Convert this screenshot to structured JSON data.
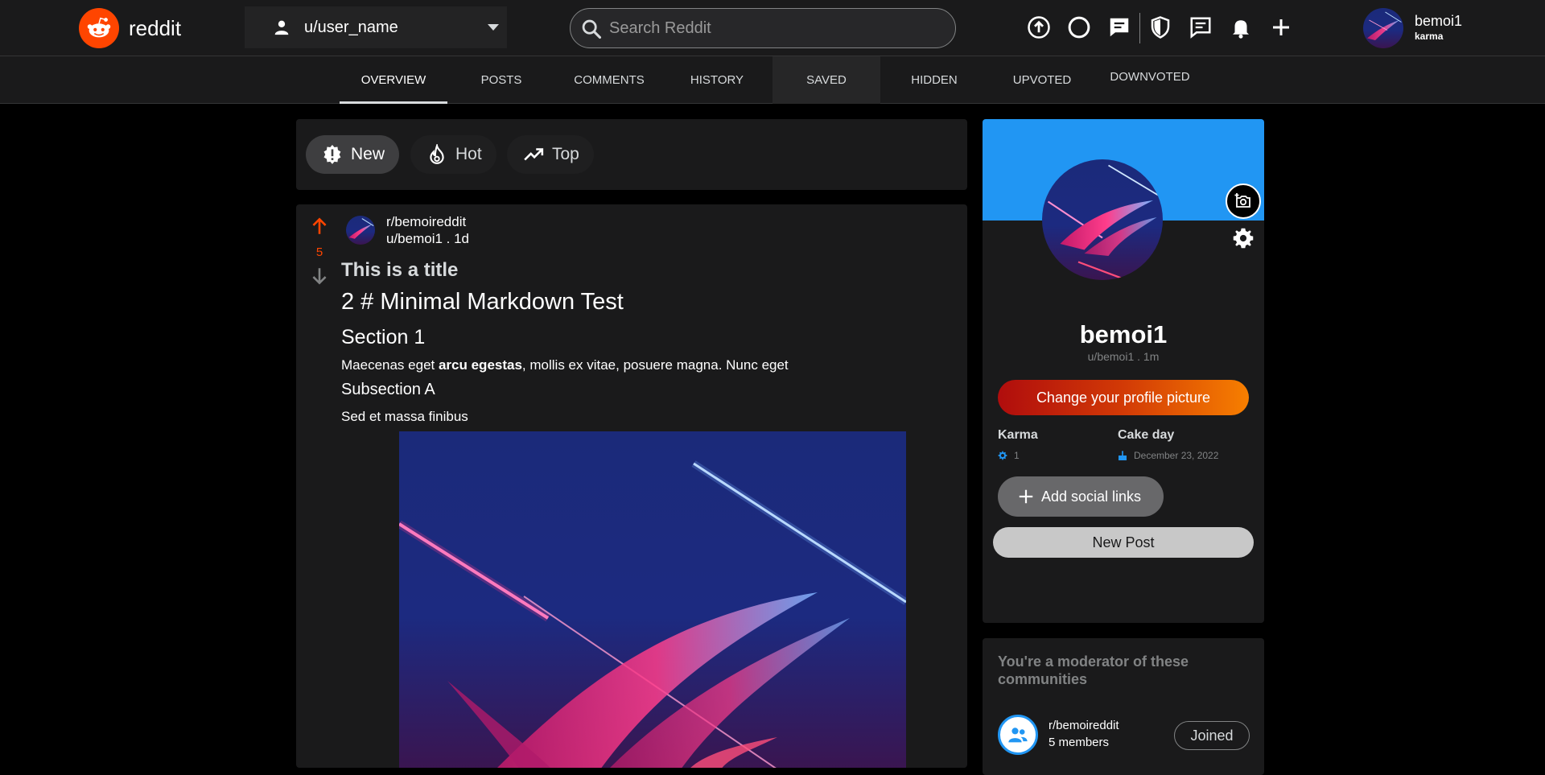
{
  "header": {
    "brand": "reddit",
    "user_select": "u/user_name",
    "search_placeholder": "Search Reddit",
    "me": {
      "name": "bemoi1",
      "karma_label": "karma"
    }
  },
  "tabs": [
    "OVERVIEW",
    "POSTS",
    "COMMENTS",
    "HISTORY",
    "SAVED",
    "HIDDEN",
    "UPVOTED",
    "DOWNVOTED"
  ],
  "sort": {
    "new": "New",
    "hot": "Hot",
    "top": "Top"
  },
  "post": {
    "score": "5",
    "subreddit": "r/bemoireddit",
    "meta": "u/bemoi1 . 1d",
    "title": "This is a title",
    "md_h1": "2 # Minimal Markdown Test",
    "md_h2": "Section 1",
    "md_p_before": "Maecenas eget ",
    "md_p_bold": "arcu egestas",
    "md_p_after": ", mollis ex vitae, posuere magna. Nunc eget",
    "md_h3": "Subsection A",
    "md_p2": "Sed et massa finibus"
  },
  "profile": {
    "name": "bemoi1",
    "handle": "u/bemoi1 . 1m",
    "change_picture": "Change your profile picture",
    "karma_label": "Karma",
    "karma_value": "1",
    "cakeday_label": "Cake day",
    "cakeday_value": "December 23, 2022",
    "social_label": "Add social links",
    "new_post": "New Post"
  },
  "moderator": {
    "title": "You're a moderator of these communities",
    "community": "r/bemoireddit",
    "members": "5 members",
    "joined": "Joined"
  },
  "colors": {
    "accent_orange": "#ff4500",
    "banner_blue": "#2196f3",
    "background": "#000000",
    "card": "#1a1a1b"
  }
}
